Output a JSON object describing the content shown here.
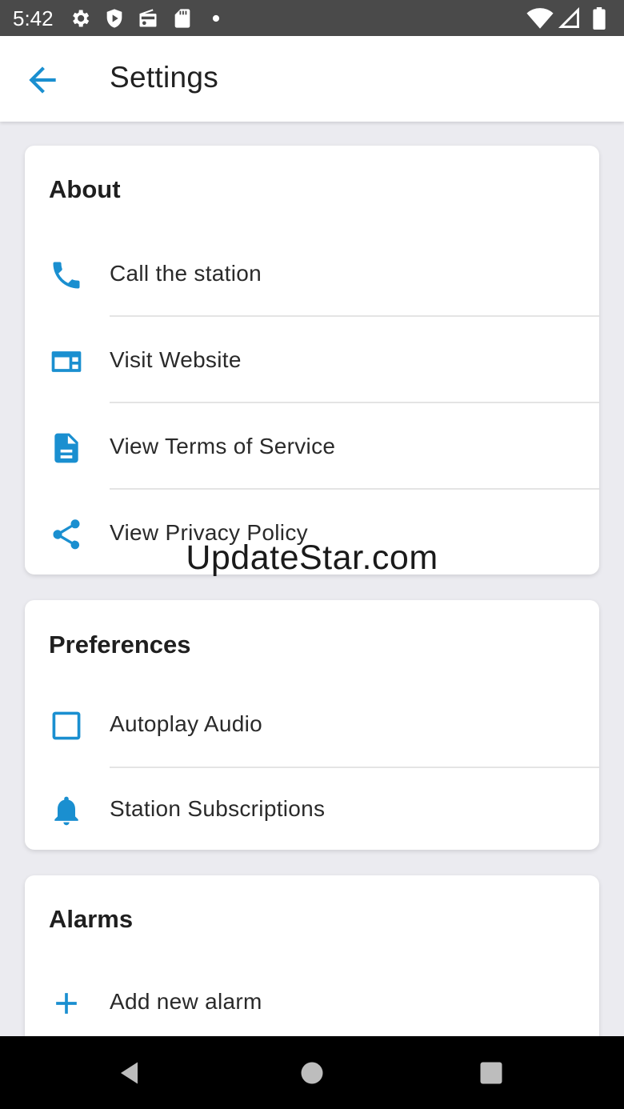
{
  "status_bar": {
    "time": "5:42",
    "left_icons": [
      "gear-icon",
      "shield-icon",
      "radio-icon",
      "sd-card-icon",
      "dot-icon"
    ],
    "right_icons": [
      "wifi-icon",
      "signal-icon",
      "battery-icon"
    ]
  },
  "app_bar": {
    "title": "Settings",
    "back_icon": "arrow-left-icon"
  },
  "accent_color": "#1a8fd0",
  "sections": {
    "about": {
      "title": "About",
      "items": [
        {
          "label": "Call the station",
          "icon": "phone-icon"
        },
        {
          "label": "Visit Website",
          "icon": "web-icon"
        },
        {
          "label": "View Terms of Service",
          "icon": "document-icon"
        },
        {
          "label": "View Privacy Policy",
          "icon": "share-icon"
        }
      ]
    },
    "preferences": {
      "title": "Preferences",
      "items": [
        {
          "label": "Autoplay Audio",
          "icon": "checkbox-icon",
          "checked": false
        },
        {
          "label": "Station Subscriptions",
          "icon": "bell-icon"
        }
      ]
    },
    "alarms": {
      "title": "Alarms",
      "items": [
        {
          "label": "Add new alarm",
          "icon": "plus-icon"
        }
      ]
    }
  },
  "watermark": "UpdateStar.com",
  "nav_bar": {
    "buttons": [
      "back-triangle-icon",
      "home-circle-icon",
      "recents-square-icon"
    ]
  }
}
